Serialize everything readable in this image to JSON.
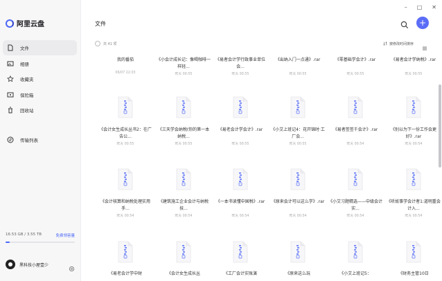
{
  "app": {
    "name": "阿里云盘"
  },
  "sidebar": {
    "items": [
      {
        "label": "文件",
        "icon": "file-icon",
        "active": true
      },
      {
        "label": "相册",
        "icon": "photo-icon"
      },
      {
        "label": "收藏夹",
        "icon": "star-icon"
      },
      {
        "label": "保险箱",
        "icon": "safe-icon"
      },
      {
        "label": "回收站",
        "icon": "trash-icon"
      }
    ],
    "transfer": {
      "label": "传输列表",
      "icon": "transfer-icon"
    },
    "storage": {
      "used": "16.53 GB / 3.55 TB",
      "link": "免费领容量",
      "fraction": 0.06
    },
    "user": {
      "name": "黑科技小屋壹少"
    }
  },
  "header": {
    "title": "文件",
    "minimize": "–",
    "maximize": "□",
    "close": "✕",
    "add": "+"
  },
  "toolbar": {
    "count": "共 41 项",
    "sort": "按修改时间排序"
  },
  "files": [
    {
      "name": "我的番茄",
      "meta": "06/07 22:03",
      "type": "folder"
    },
    {
      "name": "《小会计成长记：像喝咖啡一样轻...",
      "meta": "昨天 00:55"
    },
    {
      "name": "《易者会计学行政事业单位会...",
      "meta": "昨天 00:55"
    },
    {
      "name": "《出纳入门一点通》.rar",
      "meta": "昨天 00:55"
    },
    {
      "name": "《零基础学会计》.rar",
      "meta": "昨天 00:55"
    },
    {
      "name": "《易者会计学纳税》.rar",
      "meta": "昨天 00:55"
    },
    {
      "name": "《会计女生成长丛书2：在广告公...",
      "meta": "昨天 00:55"
    },
    {
      "name": "《三天学会纳税(你的第一本纳税...",
      "meta": "昨天 00:55"
    },
    {
      "name": "《易老会计学会计》.rar",
      "meta": "昨天 00:55"
    },
    {
      "name": "《小艾上班记4：花开锦时·工厂会...",
      "meta": "昨天 00:55"
    },
    {
      "name": "《易者签签千会计》.rar",
      "meta": "昨天 00:54"
    },
    {
      "name": "《别以为下一份工作会更好》.rar",
      "meta": "昨天 00:54"
    },
    {
      "name": "《会计核算和纳税处理实用手...",
      "meta": "昨天 00:54"
    },
    {
      "name": "《建筑施工企业会计与纳税技...",
      "meta": "昨天 00:54"
    },
    {
      "name": "《一本书读懂中国税》.rar",
      "meta": "昨天 00:54"
    },
    {
      "name": "《原来会计可以这么学》.rar",
      "meta": "昨天 00:54"
    },
    {
      "name": "《小艾习题精选——中级会计实...",
      "meta": "昨天 00:54"
    },
    {
      "name": "《听故事学会计者1:道明重会计入...",
      "meta": "昨天 00:54"
    },
    {
      "name": "《易老会计学中财",
      "meta": ""
    },
    {
      "name": "《会计女生成长丛",
      "meta": ""
    },
    {
      "name": "《工厂会计实账演",
      "meta": ""
    },
    {
      "name": "《原来这么玩",
      "meta": ""
    },
    {
      "name": "《小艾上班记5：",
      "meta": ""
    },
    {
      "name": "《财务主管10日",
      "meta": ""
    }
  ],
  "colors": {
    "accent": "#5b6df7",
    "brand": "#4a66f5"
  }
}
